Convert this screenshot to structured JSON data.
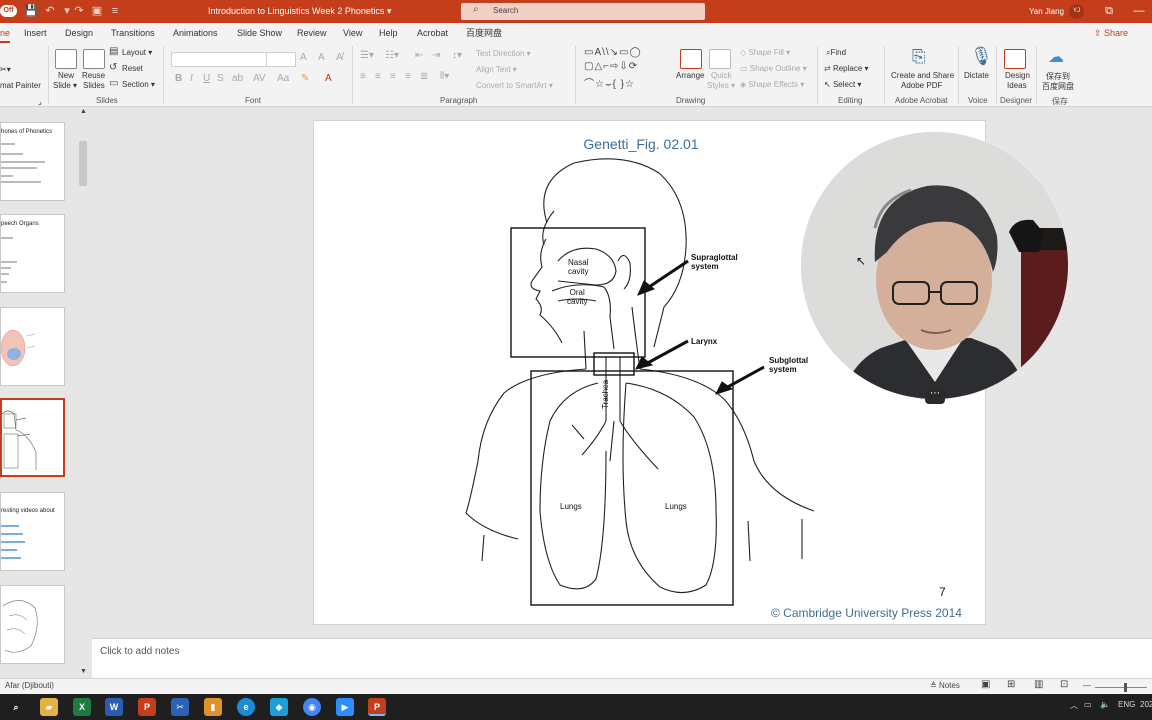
{
  "titlebar": {
    "autosave": "Off",
    "doc_title": "Introduction to Linguistics Week 2 Phonetics ▾",
    "search_placeholder": "Search",
    "user_name": "Yan Jiang",
    "user_initials": "YJ",
    "accent": "#c43e1c"
  },
  "menu": {
    "tabs": [
      "ne",
      "Insert",
      "Design",
      "Transitions",
      "Animations",
      "Slide Show",
      "Review",
      "View",
      "Help",
      "Acrobat",
      "百度网盘"
    ],
    "share_label": "Share"
  },
  "ribbon": {
    "format_painter": "mat Painter",
    "new_slide": [
      "New",
      "Slide ▾"
    ],
    "reuse_slides": [
      "Reuse",
      "Slides"
    ],
    "layout": "Layout ▾",
    "reset": "Reset",
    "section": "Section ▾",
    "text_direction": "Text Direction ▾",
    "align_text": "Align Text ▾",
    "convert_smartart": "Convert to SmartArt ▾",
    "arrange": "Arrange",
    "quick_styles": [
      "Quick",
      "Styles ▾"
    ],
    "shape_fill": "Shape Fill ▾",
    "shape_outline": "Shape Outline ▾",
    "shape_effects": "Shape Effects ▾",
    "find": "Find",
    "replace": "Replace ▾",
    "select": "Select ▾",
    "create_pdf": [
      "Create and Share",
      "Adobe PDF"
    ],
    "dictate": "Dictate",
    "design_ideas": [
      "Design",
      "Ideas"
    ],
    "baidu_save": [
      "保存到",
      "百度网盘"
    ],
    "groups": {
      "slides": "Slides",
      "font": "Font",
      "paragraph": "Paragraph",
      "drawing": "Drawing",
      "editing": "Editing",
      "adobe_acrobat": "Adobe Acrobat",
      "voice": "Voice",
      "designer": "Designer",
      "save": "保存"
    }
  },
  "thumbnails": [
    {
      "title": "hones of Phonetics",
      "selected": false
    },
    {
      "title": "peech Organs",
      "selected": false
    },
    {
      "title": "",
      "selected": false
    },
    {
      "title": "",
      "selected": true
    },
    {
      "title": "resting videos about",
      "selected": false
    },
    {
      "title": "",
      "selected": false
    }
  ],
  "slide": {
    "title": "Genetti_Fig. 02.01",
    "number": "7",
    "copyright": "© Cambridge University Press 2014",
    "labels": {
      "nasal": [
        "Nasal",
        "cavity"
      ],
      "oral": [
        "Oral",
        "cavity"
      ],
      "supraglottal": [
        "Supraglottal",
        "system"
      ],
      "larynx": "Larynx",
      "subglottal": [
        "Subglottal",
        "system"
      ],
      "trachea": "Trachea",
      "lungs_left": "Lungs",
      "lungs_right": "Lungs"
    }
  },
  "notes_placeholder": "Click to add notes",
  "status": {
    "language": "Afar (Djibouti)",
    "notes": "Notes"
  },
  "taskbar": {
    "apps": [
      "file-explorer",
      "excel",
      "word",
      "powerpoint",
      "snipping",
      "files",
      "edge",
      "kite",
      "chrome",
      "zoom",
      "powerpoint-active"
    ],
    "tray_lang": "ENG",
    "clock": "202"
  }
}
